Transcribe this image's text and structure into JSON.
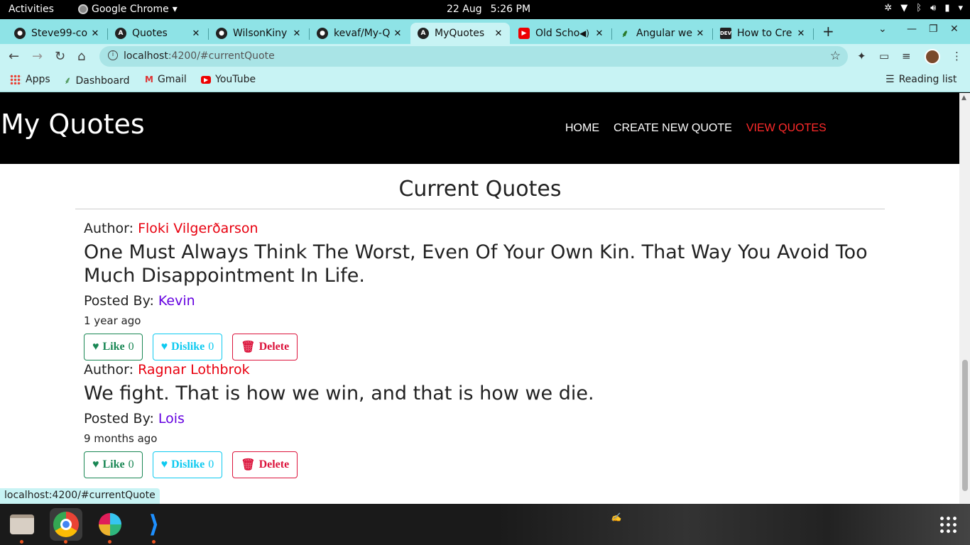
{
  "system": {
    "activities": "Activities",
    "app_name": "Google Chrome",
    "date": "22 Aug",
    "time": "5:26 PM"
  },
  "tabs": [
    {
      "title": "Steve99-co",
      "icon": "github-icon"
    },
    {
      "title": "Quotes",
      "icon": "angular-icon"
    },
    {
      "title": "WilsonKiny",
      "icon": "github-icon"
    },
    {
      "title": "kevaf/My-Q",
      "icon": "github-icon"
    },
    {
      "title": "MyQuotes",
      "icon": "angular-icon",
      "active": true
    },
    {
      "title": "Old Scho",
      "icon": "youtube-icon"
    },
    {
      "title": "Angular we",
      "icon": "palm-icon"
    },
    {
      "title": "How to Cre",
      "icon": "dev-icon"
    }
  ],
  "address": {
    "host": "localhost",
    "path": ":4200/#currentQuote"
  },
  "bookmarks": {
    "items": [
      "Apps",
      "Dashboard",
      "Gmail",
      "YouTube"
    ],
    "reading_list": "Reading list"
  },
  "site": {
    "brand": "My Quotes",
    "nav": [
      "HOME",
      "CREATE NEW QUOTE",
      "VIEW QUOTES"
    ],
    "active_nav": "VIEW QUOTES",
    "heading": "Current Quotes"
  },
  "labels": {
    "author": "Author:",
    "posted_by": "Posted By:",
    "like": "Like",
    "dislike": "Dislike",
    "delete": "Delete"
  },
  "quotes": [
    {
      "author": "Floki Vilgerðarson",
      "text": "One Must Always Think The Worst, Even Of Your Own Kin. That Way You Avoid Too Much Disappointment In Life.",
      "posted_by": "Kevin",
      "ago": "1 year ago",
      "likes": "0",
      "dislikes": "0"
    },
    {
      "author": "Ragnar Lothbrok",
      "text": "We fight. That is how we win, and that is how we die.",
      "posted_by": "Lois",
      "ago": "9 months ago",
      "likes": "0",
      "dislikes": "0"
    }
  ],
  "status_url": "localhost:4200/#currentQuote",
  "colors": {
    "tabstrip": "#8ee3e6",
    "toolbar": "#c8f3f4",
    "navbar": "#000000",
    "active_nav": "#ff2a2a",
    "author_name": "#e8000f",
    "poster_name": "#6400e0",
    "like": "#198754",
    "dislike": "#0dcaf0",
    "delete": "#dc143c"
  }
}
